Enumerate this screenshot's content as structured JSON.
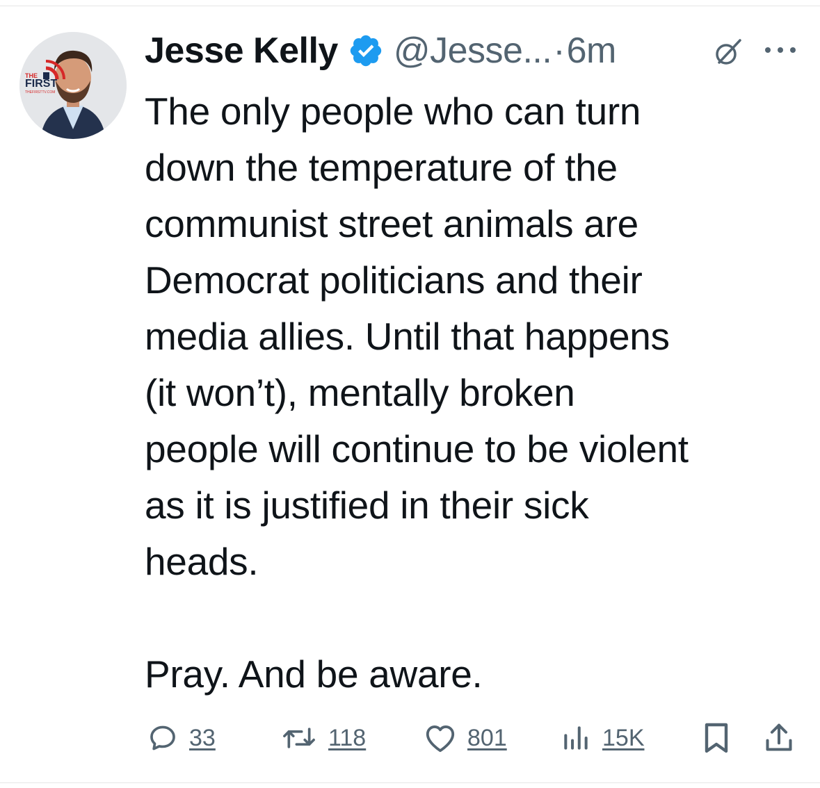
{
  "tweet": {
    "author": {
      "display_name": "Jesse Kelly",
      "handle": "@Jesse...",
      "verified": true,
      "avatar_badge_lines": [
        "THE",
        "FIRST",
        "THEFIRSTTV.COM"
      ]
    },
    "separator": "·",
    "time": "6m",
    "text_lines": [
      "The only people who can turn",
      "down the temperature of the",
      "communist street animals are",
      "Democrat politicians and their",
      "media allies. Until that happens",
      "(it won’t), mentally broken",
      "people will continue to be violent",
      "as it is justified in their sick",
      "heads."
    ],
    "closing_line": "Pray. And be aware.",
    "stats": {
      "replies": "33",
      "reposts": "118",
      "likes": "801",
      "views": "15K"
    }
  },
  "icons": {
    "verified": "verified-badge-icon",
    "grok": "grok-icon",
    "more": "more-dots-icon",
    "reply": "reply-bubble-icon",
    "repost": "repost-arrows-icon",
    "like": "heart-icon",
    "views": "views-bar-chart-icon",
    "bookmark": "bookmark-icon",
    "share": "share-upload-icon"
  },
  "colors": {
    "text_primary": "#0f1419",
    "text_secondary": "#536471",
    "verified_blue": "#1d9bf0",
    "brand_red": "#d62828",
    "brand_navy": "#1b2a4a"
  }
}
